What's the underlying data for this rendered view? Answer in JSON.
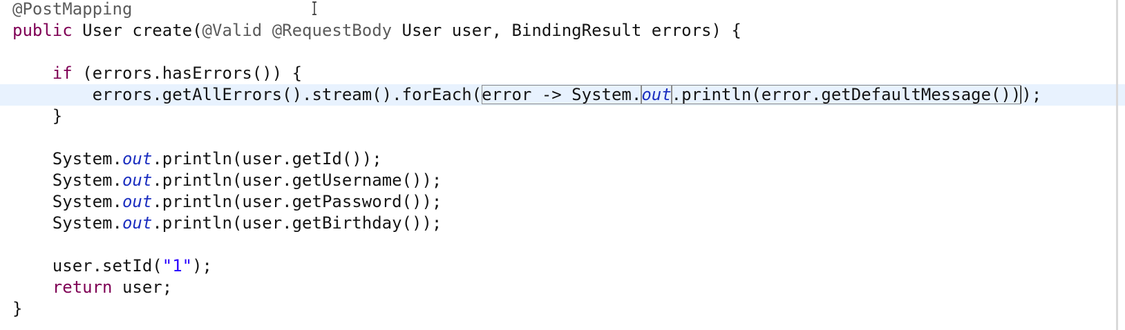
{
  "editor": {
    "colors": {
      "keyword": "#7f0055",
      "annotation": "#5b5b5b",
      "static_field": "#1c2fc0",
      "string": "#2a00ff",
      "current_line": "#e8f2fe"
    },
    "current_line_index": 4,
    "lines": [
      [
        {
          "t": "@PostMapping",
          "c": "ann"
        }
      ],
      [
        {
          "t": "public",
          "c": "kw"
        },
        {
          "t": " User create(",
          "c": "plain"
        },
        {
          "t": "@Valid",
          "c": "ann"
        },
        {
          "t": " ",
          "c": "plain"
        },
        {
          "t": "@RequestBody",
          "c": "ann"
        },
        {
          "t": " User user, BindingResult errors) {",
          "c": "plain"
        }
      ],
      [],
      [
        {
          "t": "    ",
          "c": "plain"
        },
        {
          "t": "if",
          "c": "kw"
        },
        {
          "t": " (errors.hasErrors()) {",
          "c": "plain"
        }
      ],
      [
        {
          "t": "        errors.getAllErrors().stream().forEach(",
          "c": "plain"
        },
        {
          "t": "error -> System.",
          "c": "plain",
          "box": true
        },
        {
          "t": "out",
          "c": "static",
          "box": true
        },
        {
          "t": ".println(error.getDefaultMessage())",
          "c": "plain",
          "box": true
        },
        {
          "t": "",
          "c": "caret"
        },
        {
          "t": ");",
          "c": "plain"
        }
      ],
      [
        {
          "t": "    }",
          "c": "plain"
        }
      ],
      [],
      [
        {
          "t": "    System.",
          "c": "plain"
        },
        {
          "t": "out",
          "c": "static"
        },
        {
          "t": ".println(user.getId());",
          "c": "plain"
        }
      ],
      [
        {
          "t": "    System.",
          "c": "plain"
        },
        {
          "t": "out",
          "c": "static"
        },
        {
          "t": ".println(user.getUsername());",
          "c": "plain"
        }
      ],
      [
        {
          "t": "    System.",
          "c": "plain"
        },
        {
          "t": "out",
          "c": "static"
        },
        {
          "t": ".println(user.getPassword());",
          "c": "plain"
        }
      ],
      [
        {
          "t": "    System.",
          "c": "plain"
        },
        {
          "t": "out",
          "c": "static"
        },
        {
          "t": ".println(user.getBirthday());",
          "c": "plain"
        }
      ],
      [],
      [
        {
          "t": "    user.setId(",
          "c": "plain"
        },
        {
          "t": "\"1\"",
          "c": "str"
        },
        {
          "t": ");",
          "c": "plain"
        }
      ],
      [
        {
          "t": "    ",
          "c": "plain"
        },
        {
          "t": "return",
          "c": "kw"
        },
        {
          "t": " user;",
          "c": "plain"
        }
      ],
      [
        {
          "t": "}",
          "c": "plain"
        }
      ]
    ]
  }
}
